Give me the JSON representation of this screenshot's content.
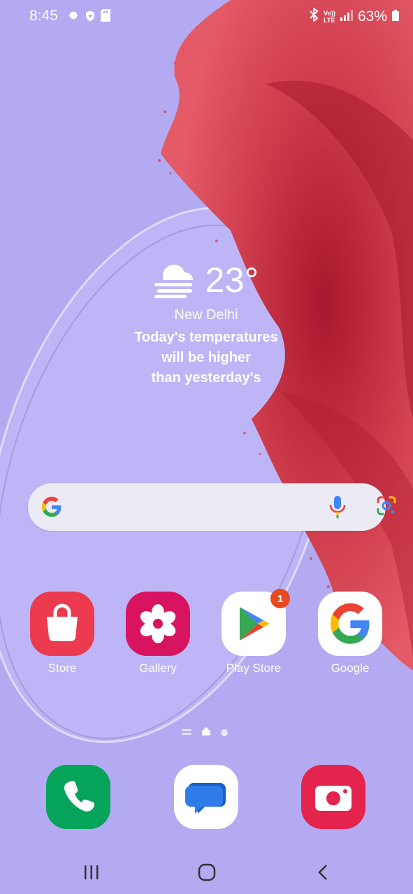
{
  "status_bar": {
    "time": "8:45",
    "left_icons": [
      "gear-icon",
      "shield-icon",
      "sd-card-icon"
    ],
    "right_icons": [
      "bluetooth-icon",
      "volte-icon",
      "signal-icon",
      "battery-icon"
    ],
    "volte_label_top": "Vo))",
    "volte_label_bottom": "LTE",
    "battery_percent": "63%"
  },
  "weather": {
    "icon": "fog-cloud-icon",
    "temperature": "23°",
    "city": "New Delhi",
    "message_line1": "Today's temperatures",
    "message_line2": "will be higher",
    "message_line3": "than yesterday's"
  },
  "search": {
    "logo": "google-g-icon",
    "voice_icon": "mic-icon",
    "lens_icon": "google-lens-icon"
  },
  "apps": [
    {
      "label": "Store",
      "icon": "shopping-bag-icon",
      "color": "#ec3a4f"
    },
    {
      "label": "Gallery",
      "icon": "flower-icon",
      "color": "#d8135f"
    },
    {
      "label": "Play Store",
      "icon": "play-triangle-icon",
      "color": "#ffffff",
      "badge": "1"
    },
    {
      "label": "Google",
      "icon": "google-g-icon",
      "color": "#ffffff"
    }
  ],
  "dock": [
    {
      "name": "phone",
      "icon": "phone-handset-icon",
      "color": "#06a35a"
    },
    {
      "name": "messages",
      "icon": "message-bubble-icon",
      "color": "#ffffff"
    },
    {
      "name": "camera",
      "icon": "camera-icon",
      "color": "#e5244d"
    }
  ],
  "navigation": {
    "recents": "recents-icon",
    "home": "home-icon",
    "back": "back-icon"
  },
  "colors": {
    "wallpaper_bg": "#b3aaf2",
    "wallpaper_accent": "#d43a4f"
  }
}
